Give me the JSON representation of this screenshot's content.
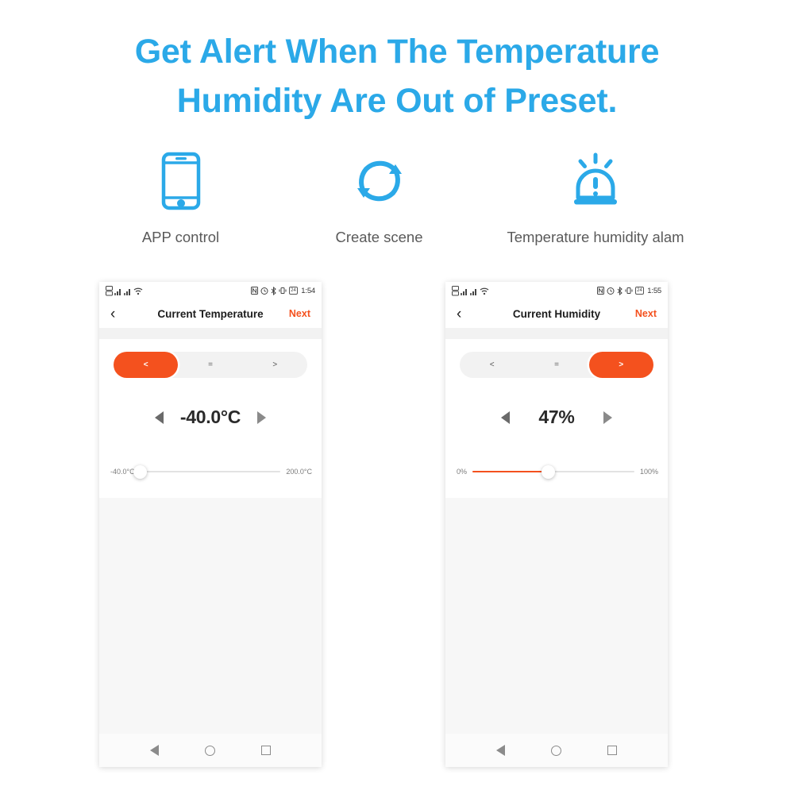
{
  "headline": {
    "line1": "Get Alert When The Temperature",
    "line2": "Humidity Are Out of Preset.",
    "color": "#2BA9E8"
  },
  "features": [
    {
      "icon": "phone-icon",
      "label": "APP control"
    },
    {
      "icon": "refresh-sync-icon",
      "label": "Create scene"
    },
    {
      "icon": "alarm-siren-icon",
      "label": "Temperature humidity alam"
    }
  ],
  "accent": {
    "orange": "#F4511E",
    "blue": "#2BA9E8"
  },
  "phones": [
    {
      "statusbar": {
        "icons": [
          "sim1-icon",
          "signal1-icon",
          "sim2-icon",
          "signal2-icon",
          "wifi-icon"
        ],
        "right_icons": [
          "nfc-icon",
          "alarm-clock-icon",
          "bluetooth-icon",
          "vibrate-icon"
        ],
        "battery": "24",
        "time": "1:54"
      },
      "header": {
        "back": "‹",
        "title": "Current Temperature",
        "next": "Next"
      },
      "segmented": {
        "options": [
          "<",
          "=",
          ">"
        ],
        "selected_index": 0
      },
      "stepper": {
        "decrement": "◀",
        "value": "-40.0°C",
        "increment": "▶"
      },
      "slider": {
        "min_label": "-40.0°C",
        "max_label": "200.0°C",
        "percent": 0,
        "fill_color": "#F4511E"
      },
      "bottomnav": [
        "back-triangle-icon",
        "home-circle-icon",
        "recents-square-icon"
      ]
    },
    {
      "statusbar": {
        "icons": [
          "sim1-icon",
          "signal1-icon",
          "sim2-icon",
          "signal2-icon",
          "wifi-icon"
        ],
        "right_icons": [
          "nfc-icon",
          "alarm-clock-icon",
          "bluetooth-icon",
          "vibrate-icon"
        ],
        "battery": "24",
        "time": "1:55"
      },
      "header": {
        "back": "‹",
        "title": "Current Humidity",
        "next": "Next"
      },
      "segmented": {
        "options": [
          "<",
          "=",
          ">"
        ],
        "selected_index": 2
      },
      "stepper": {
        "decrement": "◀",
        "value": "47%",
        "increment": "▶"
      },
      "slider": {
        "min_label": "0%",
        "max_label": "100%",
        "percent": 47,
        "fill_color": "#F4511E"
      },
      "bottomnav": [
        "back-triangle-icon",
        "home-circle-icon",
        "recents-square-icon"
      ]
    }
  ]
}
